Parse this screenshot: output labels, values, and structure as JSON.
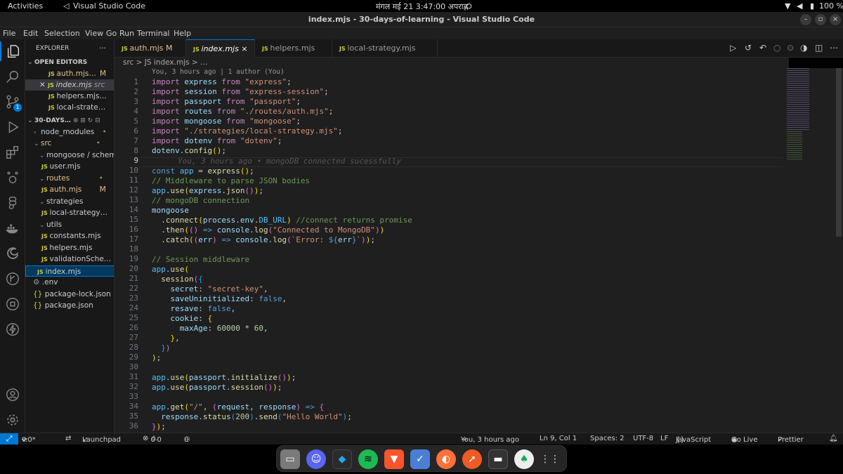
{
  "system": {
    "activities": "Activities",
    "app_name": "Visual Studio Code",
    "datetime": "मंगल मई 21  3:47:00 अपराह्ण",
    "battery": "100 %"
  },
  "window": {
    "title": "index.mjs - 30-days-of-learning - Visual Studio Code"
  },
  "menu": [
    "File",
    "Edit",
    "Selection",
    "View",
    "Go",
    "Run",
    "Terminal",
    "Help"
  ],
  "explorer": {
    "title": "EXPLORER",
    "more": "···",
    "open_editors_label": "OPEN EDITORS",
    "open_editors": [
      {
        "name": "auth.mjs…",
        "badge": "M"
      },
      {
        "name": "index.mjs",
        "badge": "src"
      },
      {
        "name": "helpers.mjs…",
        "badge": ""
      },
      {
        "name": "local-strate…",
        "badge": ""
      }
    ],
    "workspace_label": "30-DAYS…",
    "tree": [
      {
        "name": "node_modules",
        "badge": "•"
      },
      {
        "name": "src",
        "badge": "•"
      },
      {
        "name": "mongoose / schem…",
        "badge": ""
      },
      {
        "name": "user.mjs",
        "badge": ""
      },
      {
        "name": "routes",
        "badge": "•"
      },
      {
        "name": "auth.mjs",
        "badge": "M"
      },
      {
        "name": "strategies",
        "badge": ""
      },
      {
        "name": "local-strategy…",
        "badge": ""
      },
      {
        "name": "utils",
        "badge": ""
      },
      {
        "name": "constants.mjs",
        "badge": ""
      },
      {
        "name": "helpers.mjs",
        "badge": ""
      },
      {
        "name": "validationSche…",
        "badge": ""
      },
      {
        "name": "index.mjs",
        "badge": ""
      },
      {
        "name": ".env",
        "badge": ""
      },
      {
        "name": "package-lock.json",
        "badge": ""
      },
      {
        "name": "package.json",
        "badge": ""
      }
    ]
  },
  "tabs": [
    {
      "name": "auth.mjs",
      "badge": "M"
    },
    {
      "name": "index.mjs",
      "badge": "×"
    },
    {
      "name": "helpers.mjs",
      "badge": ""
    },
    {
      "name": "local-strategy.mjs",
      "badge": ""
    }
  ],
  "breadcrumb": "src > JS index.mjs > …",
  "blame": "You, 3 hours ago | 1 author (You)",
  "code": {
    "lines": [
      "1",
      "2",
      "3",
      "4",
      "5",
      "6",
      "7",
      "8",
      "9",
      "10",
      "11",
      "12",
      "13",
      "14",
      "15",
      "16",
      "17",
      "18",
      "19",
      "20",
      "21",
      "22",
      "23",
      "24",
      "25",
      "26",
      "27",
      "28",
      "29",
      "30",
      "31",
      "32",
      "33",
      "34",
      "35",
      "36"
    ],
    "l1": "import express from \"express\";",
    "l2": "import session from \"express-session\";",
    "l3": "import passport from \"passport\";",
    "l4": "import routes from \"./routes/auth.mjs\";",
    "l5": "import mongoose from \"mongoose\";",
    "l6": "import \"./strategies/local-strategy.mjs\";",
    "l7": "import dotenv from \"dotenv\";",
    "l8": "dotenv.config();",
    "l9_hint": "You, 3 hours ago • mongoDB connected sucessfully",
    "l10": "const app = express();",
    "l11": "// Middleware to parse JSON bodies",
    "l12": "app.use(express.json());",
    "l13": "// mongoDB connection",
    "l14": "mongoose",
    "l15a": "  .connect(process.env.DB_URL) ",
    "l15b": "//connect returns promise",
    "l16": "  .then(() => console.log(\"Connected to MongoDB\"))",
    "l17": "  .catch((err) => console.log(`Error: ${err}`));",
    "l19": "// Session middleware",
    "l20": "app.use(",
    "l21": "  session({",
    "l22": "    secret: \"secret-key\",",
    "l23": "    saveUninitialized: false,",
    "l24": "    resave: false,",
    "l25": "    cookie: {",
    "l26": "      maxAge: 60000 * 60,",
    "l27": "    },",
    "l28": "  })",
    "l29": ");",
    "l31": "app.use(passport.initialize());",
    "l32": "app.use(passport.session());",
    "l34": "app.get(\"/\", (request, response) => {",
    "l35": "  response.status(200).send(\"Hello World\");",
    "l36": "});"
  },
  "status": {
    "branch": "v.0*",
    "launchpad": "Launchpad",
    "errors": "0",
    "warnings": "0",
    "ports": "0",
    "blame": "You, 3 hours ago",
    "position": "Ln 9, Col 1",
    "spaces": "Spaces: 2",
    "encoding": "UTF-8",
    "eol": "LF",
    "language": "JavaScript",
    "golive": "Go Live",
    "prettier": "Prettier"
  },
  "scm_badge": "1",
  "colors": {
    "accent": "#0078d4",
    "editor_bg": "#1f1f1f",
    "sidebar_bg": "#181818"
  }
}
